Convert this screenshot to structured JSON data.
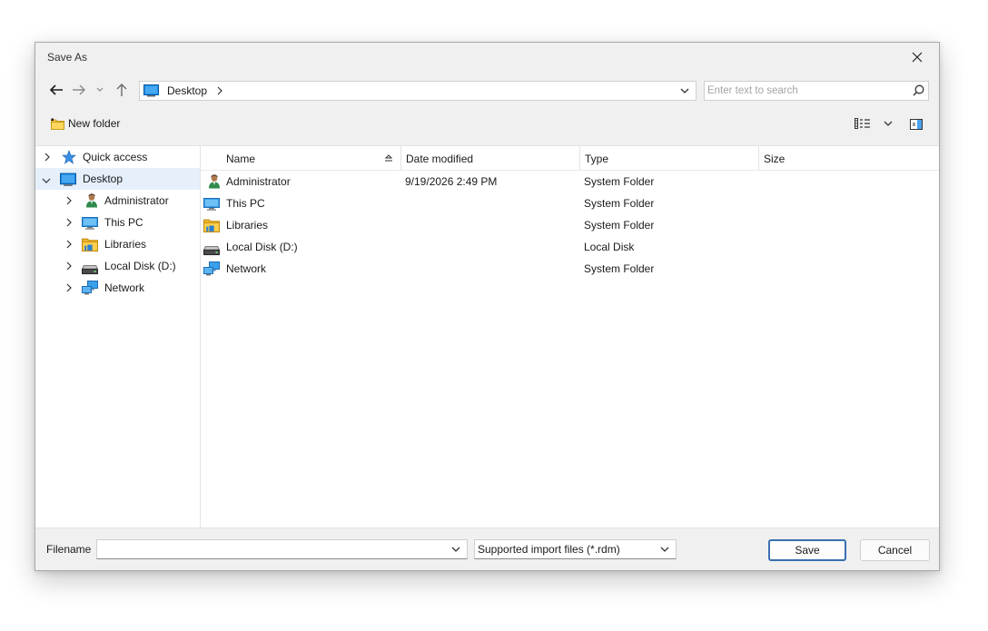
{
  "window": {
    "title": "Save As"
  },
  "address": {
    "location": "Desktop"
  },
  "search": {
    "placeholder": "Enter text to search"
  },
  "toolbar": {
    "new_folder_label": "New folder"
  },
  "tree": {
    "items": [
      {
        "label": "Quick access",
        "icon": "quick-access-icon"
      },
      {
        "label": "Desktop",
        "icon": "desktop-icon",
        "selected": true
      },
      {
        "label": "Administrator",
        "icon": "user-icon"
      },
      {
        "label": "This PC",
        "icon": "computer-icon"
      },
      {
        "label": "Libraries",
        "icon": "libraries-icon"
      },
      {
        "label": "Local Disk (D:)",
        "icon": "drive-icon"
      },
      {
        "label": "Network",
        "icon": "network-icon"
      }
    ]
  },
  "columns": [
    "Name",
    "Date modified",
    "Type",
    "Size"
  ],
  "rows": [
    {
      "name": "Administrator",
      "date": "9/19/2026 2:49 PM",
      "type": "System Folder",
      "size": "",
      "icon": "user-icon"
    },
    {
      "name": "This PC",
      "date": "",
      "type": "System Folder",
      "size": "",
      "icon": "computer-icon"
    },
    {
      "name": "Libraries",
      "date": "",
      "type": "System Folder",
      "size": "",
      "icon": "libraries-icon"
    },
    {
      "name": "Local Disk (D:)",
      "date": "",
      "type": "Local Disk",
      "size": "",
      "icon": "drive-icon"
    },
    {
      "name": "Network",
      "date": "",
      "type": "System Folder",
      "size": "",
      "icon": "network-icon"
    }
  ],
  "footer": {
    "filename_label": "Filename",
    "filename_value": "",
    "filetype_selected": "Supported import files (*.rdm)",
    "save_label": "Save",
    "cancel_label": "Cancel"
  },
  "colors": {
    "selection": "#e5f0fb",
    "accent": "#3a6fb0"
  }
}
